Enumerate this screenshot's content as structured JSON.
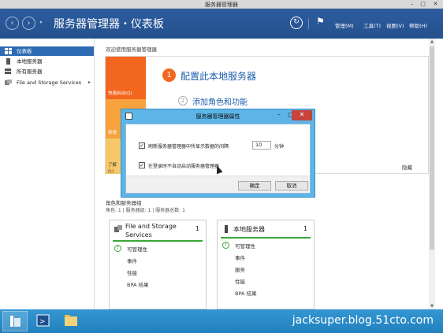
{
  "window": {
    "title": "服务器管理器",
    "controls": [
      "–",
      "□",
      "✕"
    ]
  },
  "header": {
    "app_name": "服务器管理器",
    "separator": "•",
    "page": "仪表板",
    "menus": [
      "管理(M)",
      "工具(T)",
      "视图(V)",
      "帮助(H)"
    ]
  },
  "sidebar": {
    "items": [
      {
        "label": "仪表板",
        "icon": "dashboard-icon",
        "active": true
      },
      {
        "label": "本地服务器",
        "icon": "server-icon"
      },
      {
        "label": "所有服务器",
        "icon": "servers-icon"
      },
      {
        "label": "File and Storage Services",
        "icon": "storage-icon",
        "expand": "▸"
      }
    ]
  },
  "welcome": {
    "title": "欢迎使用服务器管理器",
    "tiles": {
      "quick_start": "快速启动(Q)",
      "new": "新增",
      "learn_line1": "了解",
      "learn_line2": "(L)"
    },
    "step1_num": "1",
    "step1_text": "配置此本地服务器",
    "step2_num": "2",
    "step2_text": "添加角色和功能",
    "hide": "隐藏"
  },
  "roles": {
    "title": "角色和服务器组",
    "subtitle": "角色: 1 | 服务器组: 1 | 服务器总数: 1",
    "tiles": [
      {
        "title_line1": "File and Storage",
        "title_line2": "Services",
        "count": "1",
        "rows": [
          "可管理性",
          "事件",
          "性能",
          "BPA 结果"
        ]
      },
      {
        "title_line1": "本地服务器",
        "title_line2": "",
        "count": "1",
        "rows": [
          "可管理性",
          "事件",
          "服务",
          "性能",
          "BPA 结果"
        ]
      }
    ]
  },
  "dialog": {
    "title": "服务器管理器属性",
    "controls": [
      "–",
      "□",
      "✕"
    ],
    "option1_label": "刷新服务器管理器中所显示数据的间隔",
    "option1_checked": true,
    "interval_value": "10",
    "interval_unit": "分钟",
    "option2_label": "在登录时不自动启动服务器管理器",
    "option2_checked": true,
    "ok": "确定",
    "cancel": "取消"
  },
  "taskbar": {
    "watermark": "jacksuper.blog.51cto.com"
  },
  "colors": {
    "header_blue": "#2b5797",
    "accent_orange": "#f2661f",
    "link_blue": "#1f5fae",
    "status_green": "#3aa63a",
    "taskbar_blue": "#2a8cc7"
  }
}
